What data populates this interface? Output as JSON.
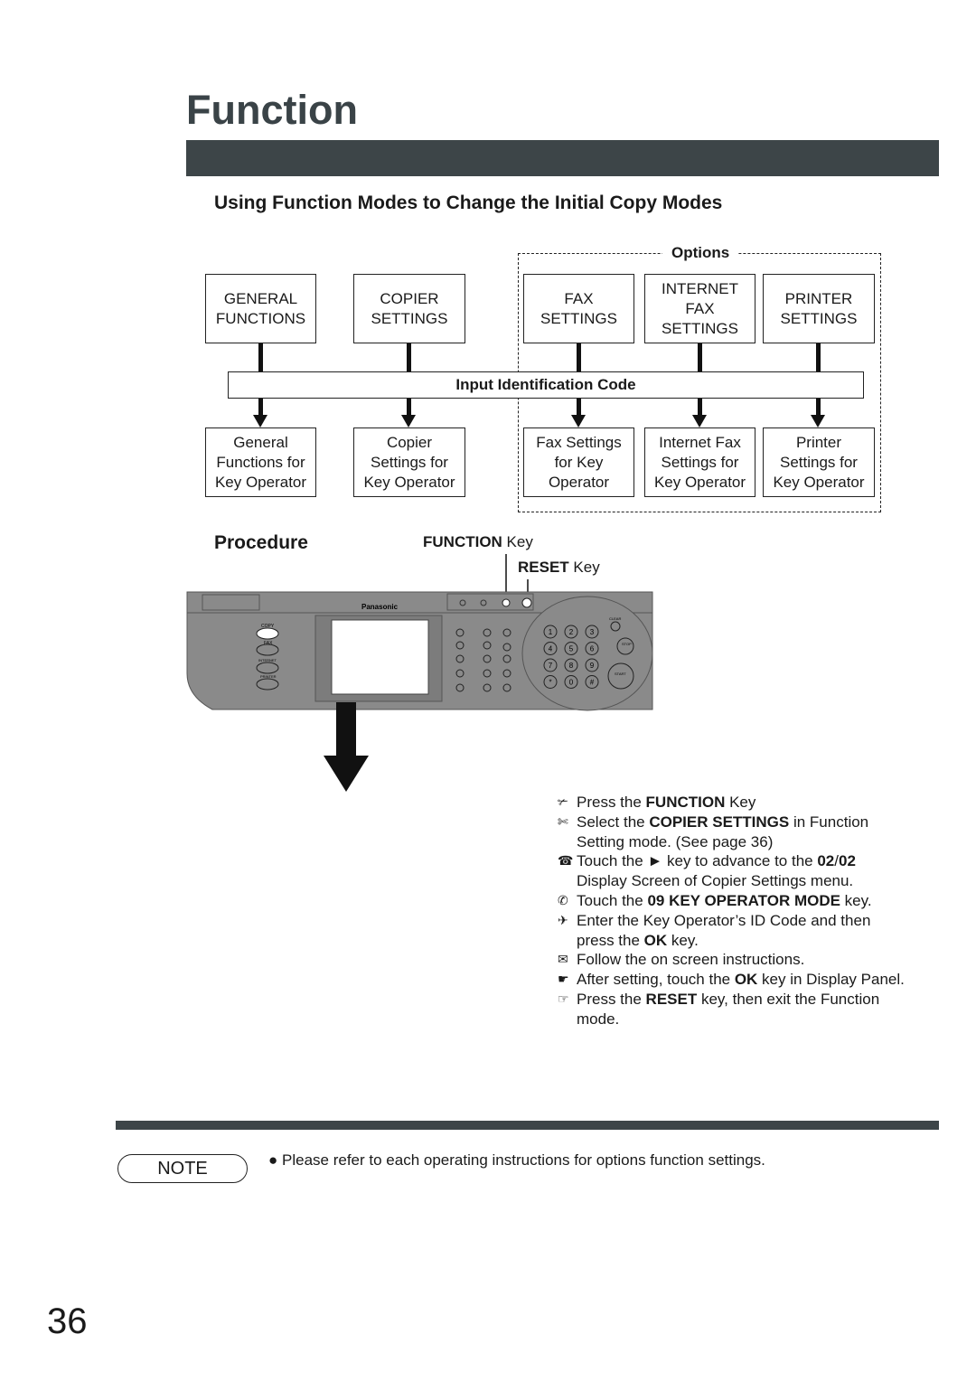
{
  "title": "Function",
  "subtitle": "Using Function Modes to Change the Initial Copy Modes",
  "diagram": {
    "options_label": "Options",
    "top_boxes": [
      "GENERAL\nFUNCTIONS",
      "COPIER\nSETTINGS",
      "FAX\nSETTINGS",
      "INTERNET\nFAX\nSETTINGS",
      "PRINTER\nSETTINGS"
    ],
    "input_code": "Input Identification Code",
    "bottom_boxes": [
      "General\nFunctions for\nKey Operator",
      "Copier\nSettings for\nKey Operator",
      "Fax Settings\nfor Key\nOperator",
      "Internet Fax\nSettings for\nKey Operator",
      "Printer\nSettings for\nKey Operator"
    ]
  },
  "procedure": {
    "heading": "Procedure",
    "function_key": {
      "bold": "FUNCTION",
      "rest": " Key"
    },
    "reset_key": {
      "bold": "RESET",
      "rest": " Key"
    },
    "panel": {
      "brand": "Panasonic",
      "mode_keys": [
        "COPY",
        "FAX",
        "INTERNET",
        "PRINTER"
      ],
      "keypad": [
        "1",
        "2",
        "3",
        "4",
        "5",
        "6",
        "7",
        "8",
        "9",
        "*",
        "0",
        "#"
      ],
      "stop": "STOP",
      "start": "START",
      "clear": "CLEAR"
    }
  },
  "steps": [
    {
      "icon": "✃",
      "parts": [
        [
          "Press the ",
          0
        ],
        [
          "FUNCTION",
          1
        ],
        [
          " Key",
          0
        ]
      ]
    },
    {
      "icon": "✄",
      "parts": [
        [
          "Select the ",
          0
        ],
        [
          "COPIER SETTINGS",
          1
        ],
        [
          " in Function Setting mode. (See page 36)",
          0
        ]
      ]
    },
    {
      "icon": "☎",
      "parts": [
        [
          "Touch the ► key to advance to the ",
          0
        ],
        [
          "02",
          1
        ],
        [
          "/",
          0
        ],
        [
          "02",
          1
        ],
        [
          " Display Screen of Copier Settings menu.",
          0
        ]
      ]
    },
    {
      "icon": "✆",
      "parts": [
        [
          "Touch the ",
          0
        ],
        [
          "09 KEY OPERATOR MODE",
          1
        ],
        [
          " key.",
          0
        ]
      ]
    },
    {
      "icon": "✈",
      "parts": [
        [
          "Enter the Key Operator’s ID Code and then press the ",
          0
        ],
        [
          "OK",
          1
        ],
        [
          " key.",
          0
        ]
      ]
    },
    {
      "icon": "✉",
      "parts": [
        [
          "Follow the on screen instructions.",
          0
        ]
      ]
    },
    {
      "icon": "☛",
      "parts": [
        [
          "After setting, touch the ",
          0
        ],
        [
          "OK",
          1
        ],
        [
          " key in Display Panel.",
          0
        ]
      ]
    },
    {
      "icon": "☞",
      "parts": [
        [
          "Press the ",
          0
        ],
        [
          "RESET",
          1
        ],
        [
          " key, then exit the Function mode.",
          0
        ]
      ]
    }
  ],
  "note": {
    "label": "NOTE",
    "bullet": "●",
    "text": "Please refer to each operating instructions for options function settings."
  },
  "page_number": "36"
}
